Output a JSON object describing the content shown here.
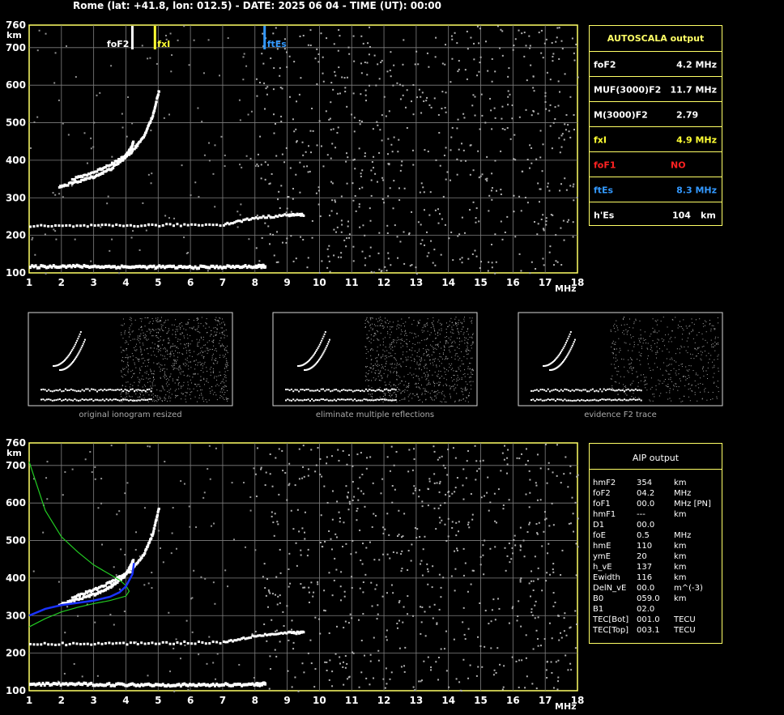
{
  "header": "Rome (lat: +41.8, lon: 012.5) - DATE: 2025 06 04 - TIME (UT): 00:00",
  "colors": {
    "frame": "#ffff66",
    "grid": "#7f7f7f",
    "echo": "#ffffff",
    "foF2": "#ffffff",
    "fxI": "#ffff33",
    "ftEs": "#3399ff",
    "foF1": "#ff2222",
    "profile": "#1a33ff",
    "model": "#22cc22"
  },
  "chart_data": [
    {
      "type": "scatter",
      "title": "",
      "xlabel": "MHz",
      "ylabel": "km",
      "xlim": [
        1,
        18
      ],
      "ylim": [
        100,
        760
      ],
      "xticks": [
        1,
        2,
        3,
        4,
        5,
        6,
        7,
        8,
        9,
        10,
        11,
        12,
        13,
        14,
        15,
        16,
        17,
        18
      ],
      "yticks": [
        100,
        200,
        300,
        400,
        500,
        600,
        700,
        760
      ],
      "grid": true,
      "markers": [
        {
          "name": "foF2",
          "x": 4.2
        },
        {
          "name": "fxI",
          "x": 4.9
        },
        {
          "name": "ftEs",
          "x": 8.3
        }
      ],
      "traces": [
        {
          "name": "E-layer",
          "points": [
            [
              1.0,
              118
            ],
            [
              2,
              120
            ],
            [
              3,
              119
            ],
            [
              4,
              118
            ],
            [
              5,
              118
            ],
            [
              6,
              117
            ],
            [
              7,
              118
            ],
            [
              8,
              119
            ],
            [
              8.3,
              120
            ]
          ]
        },
        {
          "name": "Es-layer",
          "points": [
            [
              1.0,
              225
            ],
            [
              3,
              226
            ],
            [
              5,
              228
            ],
            [
              7,
              230
            ],
            [
              8,
              248
            ],
            [
              9,
              255
            ],
            [
              9.5,
              256
            ]
          ]
        },
        {
          "name": "F2-o",
          "points": [
            [
              1.9,
              330
            ],
            [
              2.5,
              345
            ],
            [
              3,
              358
            ],
            [
              3.5,
              378
            ],
            [
              3.9,
              405
            ],
            [
              4.1,
              430
            ],
            [
              4.2,
              450
            ]
          ]
        },
        {
          "name": "F2-x",
          "points": [
            [
              2.3,
              350
            ],
            [
              3,
              370
            ],
            [
              3.6,
              395
            ],
            [
              4.1,
              420
            ],
            [
              4.5,
              460
            ],
            [
              4.8,
              520
            ],
            [
              5.0,
              590
            ]
          ]
        }
      ]
    },
    {
      "type": "scatter",
      "title": "",
      "xlabel": "MHz",
      "ylabel": "km",
      "xlim": [
        1,
        18
      ],
      "ylim": [
        100,
        760
      ],
      "xticks": [
        1,
        2,
        3,
        4,
        5,
        6,
        7,
        8,
        9,
        10,
        11,
        12,
        13,
        14,
        15,
        16,
        17,
        18
      ],
      "yticks": [
        100,
        200,
        300,
        400,
        500,
        600,
        700,
        760
      ],
      "grid": true,
      "traces": [
        {
          "name": "E-layer",
          "points": [
            [
              1.0,
              118
            ],
            [
              2,
              120
            ],
            [
              3,
              119
            ],
            [
              4,
              118
            ],
            [
              5,
              118
            ],
            [
              6,
              117
            ],
            [
              7,
              118
            ],
            [
              8,
              119
            ],
            [
              8.3,
              120
            ]
          ]
        },
        {
          "name": "Es-layer",
          "points": [
            [
              1.0,
              225
            ],
            [
              3,
              226
            ],
            [
              5,
              228
            ],
            [
              7,
              230
            ],
            [
              8,
              248
            ],
            [
              9,
              255
            ],
            [
              9.5,
              256
            ]
          ]
        },
        {
          "name": "F2-o",
          "points": [
            [
              1.9,
              330
            ],
            [
              2.5,
              345
            ],
            [
              3,
              358
            ],
            [
              3.5,
              378
            ],
            [
              3.9,
              405
            ],
            [
              4.1,
              430
            ],
            [
              4.2,
              450
            ]
          ]
        },
        {
          "name": "F2-x",
          "points": [
            [
              2.3,
              350
            ],
            [
              3,
              370
            ],
            [
              3.6,
              395
            ],
            [
              4.1,
              420
            ],
            [
              4.5,
              460
            ],
            [
              4.8,
              520
            ],
            [
              5.0,
              590
            ]
          ]
        }
      ],
      "profile": {
        "name": "",
        "points": [
          [
            1.0,
            300
          ],
          [
            1.5,
            318
          ],
          [
            2,
            328
          ],
          [
            2.5,
            334
          ],
          [
            3,
            340
          ],
          [
            3.5,
            350
          ],
          [
            3.8,
            362
          ],
          [
            4.0,
            378
          ],
          [
            4.2,
            410
          ],
          [
            4.25,
            440
          ]
        ]
      },
      "model_curve": {
        "name": "",
        "points": [
          [
            1.0,
            710
          ],
          [
            1.5,
            580
          ],
          [
            2,
            510
          ],
          [
            2.5,
            470
          ],
          [
            3,
            435
          ],
          [
            3.5,
            410
          ],
          [
            3.8,
            395
          ],
          [
            4.0,
            380
          ],
          [
            4.1,
            365
          ],
          [
            4.0,
            352
          ],
          [
            3.5,
            340
          ],
          [
            3,
            332
          ],
          [
            2.5,
            322
          ],
          [
            2,
            310
          ],
          [
            1.5,
            292
          ],
          [
            1.0,
            270
          ]
        ]
      }
    }
  ],
  "autoscala": {
    "title": "AUTOSCALA output",
    "rows": [
      {
        "label": "foF2",
        "value": "4.2 MHz",
        "color": "#ffffff"
      },
      {
        "label": "MUF(3000)F2",
        "value": "11.7 MHz",
        "color": "#ffffff"
      },
      {
        "label": "M(3000)F2",
        "value": "2.79",
        "color": "#ffffff"
      },
      {
        "label": "fxI",
        "value": "4.9 MHz",
        "color": "#ffff33"
      },
      {
        "label": "foF1",
        "value": "NO",
        "color": "#ff2222"
      },
      {
        "label": "ftEs",
        "value": "8.3 MHz",
        "color": "#3399ff"
      },
      {
        "label": "h'Es",
        "value": "104",
        "unit": "km",
        "color": "#ffffff"
      }
    ]
  },
  "aip": {
    "title": "AIP output",
    "rows": [
      {
        "label": "hmF2",
        "value": "354",
        "unit": "km"
      },
      {
        "label": "foF2",
        "value": "04.2",
        "unit": "MHz"
      },
      {
        "label": "foF1",
        "value": "00.0",
        "unit": "MHz   [PN]"
      },
      {
        "label": "hmF1",
        "value": "---",
        "unit": "km"
      },
      {
        "label": "D1",
        "value": "00.0",
        "unit": ""
      },
      {
        "label": "foE",
        "value": "0.5",
        "unit": "MHz"
      },
      {
        "label": "hmE",
        "value": "110",
        "unit": "km"
      },
      {
        "label": "ymE",
        "value": "20",
        "unit": "km"
      },
      {
        "label": "h_vE",
        "value": "137",
        "unit": "km"
      },
      {
        "label": "Ewidth",
        "value": "116",
        "unit": "km"
      },
      {
        "label": "DelN_vE",
        "value": "00.0",
        "unit": "m^(-3)"
      },
      {
        "label": "B0",
        "value": "059.0",
        "unit": "km"
      },
      {
        "label": "B1",
        "value": "02.0",
        "unit": ""
      },
      {
        "label": "TEC[Bot]",
        "value": "001.0",
        "unit": "TECU"
      },
      {
        "label": "TEC[Top]",
        "value": "003.1",
        "unit": "TECU"
      }
    ]
  },
  "thumbnails": [
    {
      "caption": "original ionogram resized"
    },
    {
      "caption": "eliminate multiple reflections"
    },
    {
      "caption": "evidence F2 trace"
    }
  ]
}
